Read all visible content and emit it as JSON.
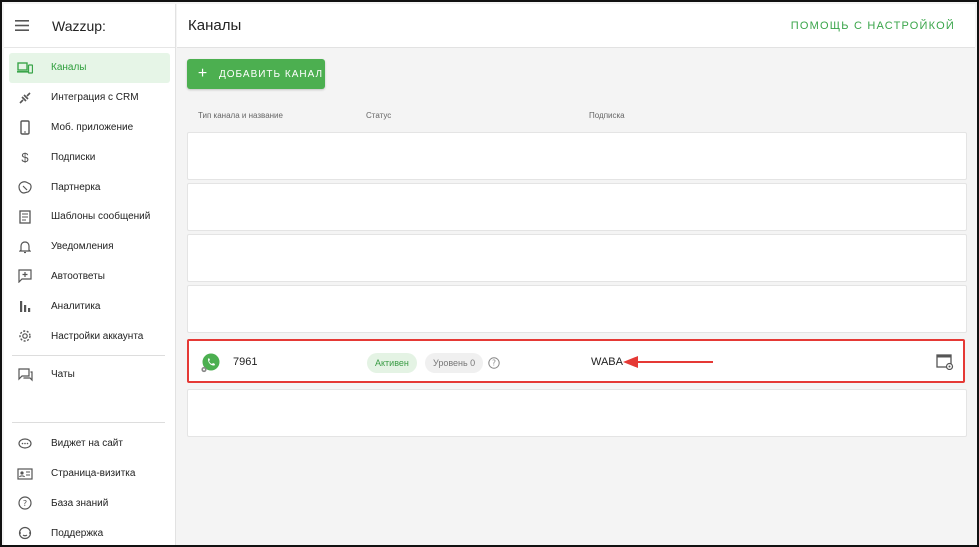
{
  "app": {
    "brand": "Wazzup:"
  },
  "sidebar": {
    "items": [
      {
        "label": "Каналы",
        "icon": "devices-icon",
        "active": true
      },
      {
        "label": "Интеграция с CRM",
        "icon": "plug-icon"
      },
      {
        "label": "Моб. приложение",
        "icon": "phone-icon"
      },
      {
        "label": "Подписки",
        "icon": "dollar-icon"
      },
      {
        "label": "Партнерка",
        "icon": "handshake-icon"
      },
      {
        "label": "Шаблоны сообщений",
        "icon": "document-icon"
      },
      {
        "label": "Уведомления",
        "icon": "bell-icon"
      },
      {
        "label": "Автоответы",
        "icon": "autoreply-icon"
      },
      {
        "label": "Аналитика",
        "icon": "bar-chart-icon"
      },
      {
        "label": "Настройки аккаунта",
        "icon": "gear-icon"
      },
      {
        "label": "Чаты",
        "icon": "chat-icon"
      }
    ],
    "bottom": [
      {
        "label": "Виджет на сайт",
        "icon": "widget-icon"
      },
      {
        "label": "Страница-визитка",
        "icon": "card-icon"
      },
      {
        "label": "База знаний",
        "icon": "help-icon"
      },
      {
        "label": "Поддержка",
        "icon": "support-icon"
      }
    ]
  },
  "header": {
    "title": "Каналы",
    "help": "ПОМОЩЬ С НАСТРОЙКОЙ"
  },
  "toolbar": {
    "add_label": "ДОБАВИТЬ КАНАЛ"
  },
  "table": {
    "columns": [
      "Тип канала и названиe",
      "Статус",
      "Подписка"
    ],
    "channel": {
      "number": "7961",
      "status": "Активен",
      "level": "Уровень 0",
      "subscription": "WABA"
    }
  },
  "colors": {
    "accent": "#4caf50",
    "highlight": "#e53935"
  }
}
